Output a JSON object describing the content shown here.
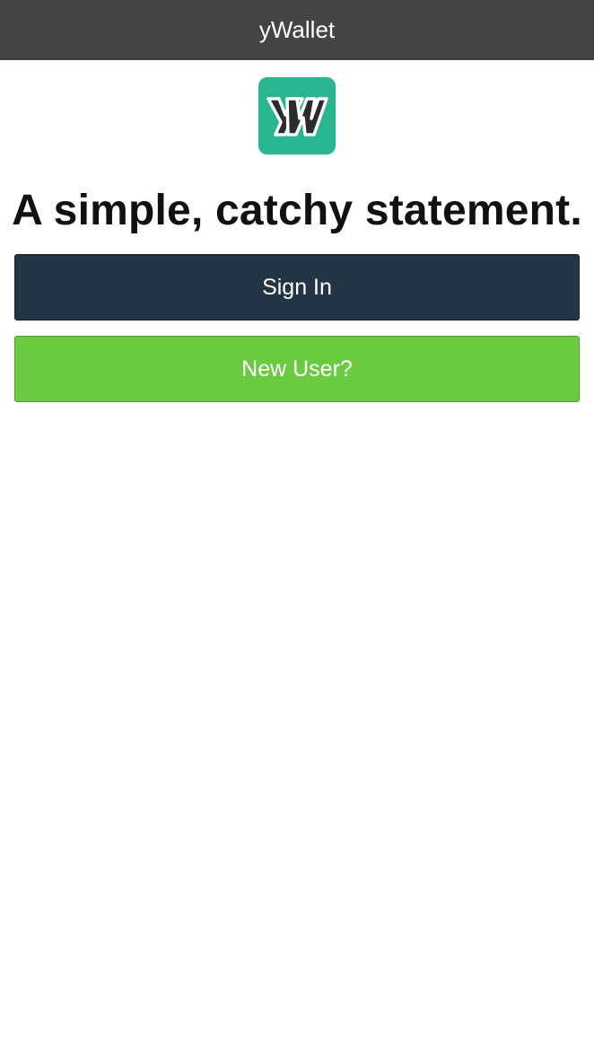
{
  "app": {
    "title": "yWallet"
  },
  "logo": {
    "icon": "yw-logo-icon",
    "mark_text": "YW",
    "background_color": "#27b592"
  },
  "tagline": "A simple, catchy statement.",
  "buttons": {
    "sign_in": {
      "label": "Sign In",
      "color": "#233545"
    },
    "new_user": {
      "label": "New User?",
      "color": "#6acb40"
    }
  },
  "colors": {
    "nav_bar": "#444444",
    "page_background": "#ffffff"
  }
}
